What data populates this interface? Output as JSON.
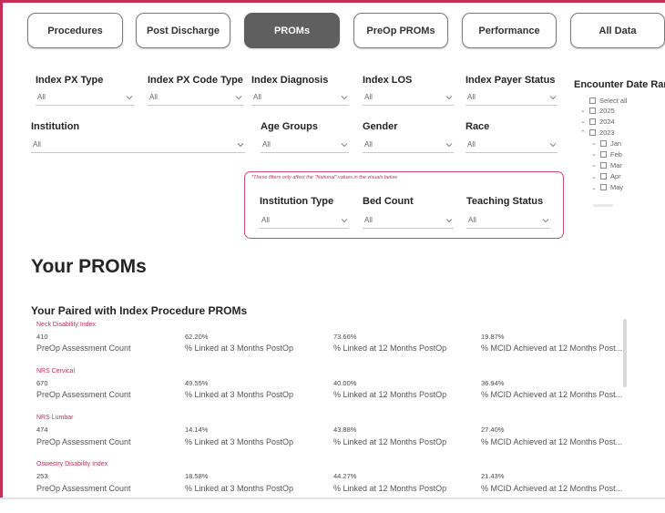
{
  "tabs": [
    {
      "label": "Procedures",
      "active": false
    },
    {
      "label": "Post Discharge",
      "active": false
    },
    {
      "label": "PROMs",
      "active": true
    },
    {
      "label": "PreOp PROMs",
      "active": false
    },
    {
      "label": "Performance",
      "active": false
    },
    {
      "label": "All Data",
      "active": false
    }
  ],
  "filters": {
    "index_px_type": {
      "label": "Index PX Type",
      "value": "All"
    },
    "index_px_code_type": {
      "label": "Index PX Code Type",
      "value": "All"
    },
    "index_diagnosis": {
      "label": "Index Diagnosis",
      "value": "All"
    },
    "index_los": {
      "label": "Index LOS",
      "value": "All"
    },
    "index_payer_status": {
      "label": "Index Payer Status",
      "value": "All"
    },
    "institution": {
      "label": "Institution",
      "value": "All"
    },
    "age_groups": {
      "label": "Age Groups",
      "value": "All"
    },
    "gender": {
      "label": "Gender",
      "value": "All"
    },
    "race": {
      "label": "Race",
      "value": "All"
    }
  },
  "national_filters": {
    "note": "*These filters only affect the \"National\" values in the visuals below",
    "institution_type": {
      "label": "Institution Type",
      "value": "All"
    },
    "bed_count": {
      "label": "Bed Count",
      "value": "All"
    },
    "teaching_status": {
      "label": "Teaching Status",
      "value": "All"
    }
  },
  "date_range": {
    "label": "Encounter Date Range",
    "items": [
      "Select all",
      "2025",
      "2024",
      "2023",
      "Jan",
      "Feb",
      "Mar",
      "Apr",
      "May"
    ]
  },
  "section_title": "Your PROMs",
  "subsection_title": "Your Paired with Index Procedure PROMs",
  "metric_captions": {
    "count": "PreOp Assessment Count",
    "m3": "% Linked at 3 Months PostOp",
    "m12": "% Linked at 12 Months PostOp",
    "mcid": "% MCID Achieved at 12 Months Post..."
  },
  "metrics": [
    {
      "name": "Neck Disability Index",
      "count": "410",
      "m3": "62.20%",
      "m12": "73.66%",
      "mcid": "19.87%"
    },
    {
      "name": "NRS Cervical",
      "count": "670",
      "m3": "49.55%",
      "m12": "40.00%",
      "mcid": "36.94%"
    },
    {
      "name": "NRS Lumbar",
      "count": "474",
      "m3": "14.14%",
      "m12": "43.88%",
      "mcid": "27.40%"
    },
    {
      "name": "Oswestry Disability Index",
      "count": "253",
      "m3": "18.58%",
      "m12": "44.27%",
      "mcid": "21.43%"
    }
  ],
  "colors": {
    "accent": "#c62e56",
    "active_tab": "#5f5f5f"
  },
  "icons": [
    "chevron-down-icon",
    "chevron-up-icon",
    "checkbox-icon"
  ]
}
